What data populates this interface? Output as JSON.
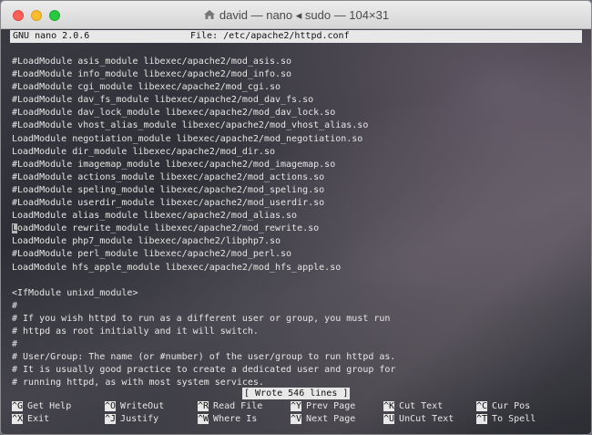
{
  "window": {
    "title": "david — nano ◂ sudo — 104×31"
  },
  "nano": {
    "version": "GNU nano 2.0.6",
    "file_label": "File: /etc/apache2/httpd.conf",
    "status_message": "[ Wrote 546 lines ]"
  },
  "lines": [
    "#LoadModule asis_module libexec/apache2/mod_asis.so",
    "#LoadModule info_module libexec/apache2/mod_info.so",
    "#LoadModule cgi_module libexec/apache2/mod_cgi.so",
    "#LoadModule dav_fs_module libexec/apache2/mod_dav_fs.so",
    "#LoadModule dav_lock_module libexec/apache2/mod_dav_lock.so",
    "#LoadModule vhost_alias_module libexec/apache2/mod_vhost_alias.so",
    "LoadModule negotiation_module libexec/apache2/mod_negotiation.so",
    "LoadModule dir_module libexec/apache2/mod_dir.so",
    "#LoadModule imagemap_module libexec/apache2/mod_imagemap.so",
    "#LoadModule actions_module libexec/apache2/mod_actions.so",
    "#LoadModule speling_module libexec/apache2/mod_speling.so",
    "#LoadModule userdir_module libexec/apache2/mod_userdir.so",
    "LoadModule alias_module libexec/apache2/mod_alias.so",
    "LoadModule rewrite_module libexec/apache2/mod_rewrite.so",
    "LoadModule php7_module libexec/apache2/libphp7.so",
    "#LoadModule perl_module libexec/apache2/mod_perl.so",
    "LoadModule hfs_apple_module libexec/apache2/mod_hfs_apple.so",
    "",
    "<IfModule unixd_module>",
    "#",
    "# If you wish httpd to run as a different user or group, you must run",
    "# httpd as root initially and it will switch.",
    "#",
    "# User/Group: The name (or #number) of the user/group to run httpd as.",
    "# It is usually good practice to create a dedicated user and group for",
    "# running httpd, as with most system services."
  ],
  "cursor_line_index": 13,
  "shortcuts": [
    {
      "key": "^G",
      "label": "Get Help"
    },
    {
      "key": "^O",
      "label": "WriteOut"
    },
    {
      "key": "^R",
      "label": "Read File"
    },
    {
      "key": "^Y",
      "label": "Prev Page"
    },
    {
      "key": "^K",
      "label": "Cut Text"
    },
    {
      "key": "^C",
      "label": "Cur Pos"
    },
    {
      "key": "^X",
      "label": "Exit"
    },
    {
      "key": "^J",
      "label": "Justify"
    },
    {
      "key": "^W",
      "label": "Where Is"
    },
    {
      "key": "^V",
      "label": "Next Page"
    },
    {
      "key": "^U",
      "label": "UnCut Text"
    },
    {
      "key": "^T",
      "label": "To Spell"
    }
  ]
}
